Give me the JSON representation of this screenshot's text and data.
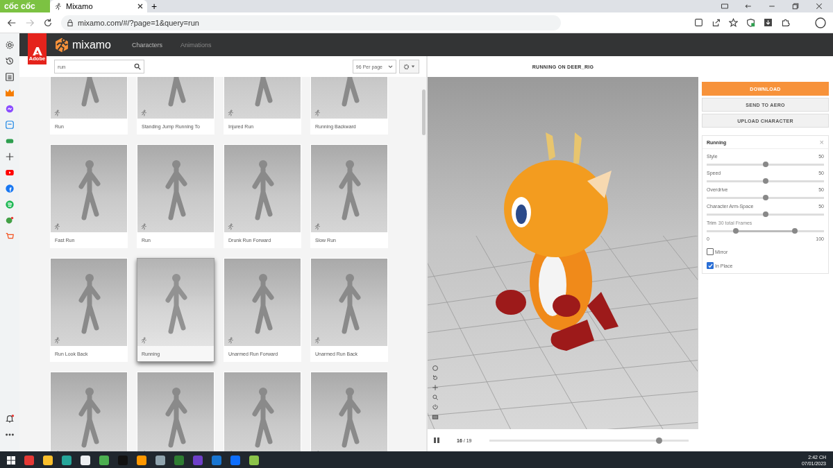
{
  "browser": {
    "brand": "cốc cốc",
    "tabs": [
      {
        "title": "Mixamo",
        "selected": true
      }
    ],
    "new_tab": "+",
    "url": "mixamo.com/#/?page=1&query=run"
  },
  "header": {
    "adobe": "Adobe",
    "logo": "mixamo",
    "nav": [
      {
        "label": "Characters",
        "selected": true
      },
      {
        "label": "Animations",
        "selected": false
      }
    ]
  },
  "toolbar": {
    "search_value": "run",
    "per_page": "96 Per page"
  },
  "cards": [
    {
      "label": "Run",
      "selected": false
    },
    {
      "label": "Standing Jump Running To",
      "selected": false
    },
    {
      "label": "Injured Run",
      "selected": false
    },
    {
      "label": "Running Backward",
      "selected": false
    },
    {
      "label": "Fast Run",
      "selected": false
    },
    {
      "label": "Run",
      "selected": false
    },
    {
      "label": "Drunk Run Forward",
      "selected": false
    },
    {
      "label": "Slow Run",
      "selected": false
    },
    {
      "label": "Run Look Back",
      "selected": false
    },
    {
      "label": "Running",
      "selected": true
    },
    {
      "label": "Unarmed Run Forward",
      "selected": false
    },
    {
      "label": "Unarmed Run Back",
      "selected": false
    },
    {
      "selected": false
    },
    {
      "selected": false
    },
    {
      "selected": false
    },
    {
      "selected": false
    }
  ],
  "viewer": {
    "title": "RUNNING ON DEER_RIG",
    "frame": "16",
    "total": "/ 19",
    "level": 0.85
  },
  "actions": [
    {
      "label": "DOWNLOAD",
      "kind": "primary"
    },
    {
      "label": "SEND TO AERO",
      "kind": "secondary"
    },
    {
      "label": "UPLOAD CHARACTER",
      "kind": "secondary"
    }
  ],
  "settings": {
    "title": "Running",
    "close": "×",
    "sliders": [
      {
        "name": "Style",
        "reading": "50",
        "level": 0.5
      },
      {
        "name": "Speed",
        "reading": "50",
        "level": 0.5
      },
      {
        "name": "Overdrive",
        "reading": "50",
        "level": 0.5
      },
      {
        "name": "Character Arm-Space",
        "reading": "50",
        "level": 0.5
      }
    ],
    "trim": {
      "name": "Trim",
      "note": "30 total Frames",
      "min": "0",
      "max": "100",
      "handles": [
        {
          "level": 0.25
        },
        {
          "level": 0.75
        }
      ]
    },
    "checkboxes": [
      {
        "label": "Mirror",
        "checked": false
      },
      {
        "label": "In Place",
        "checked": true
      }
    ]
  },
  "taskbar": {
    "time": "2:42 CH",
    "date": "07/01/2023"
  }
}
